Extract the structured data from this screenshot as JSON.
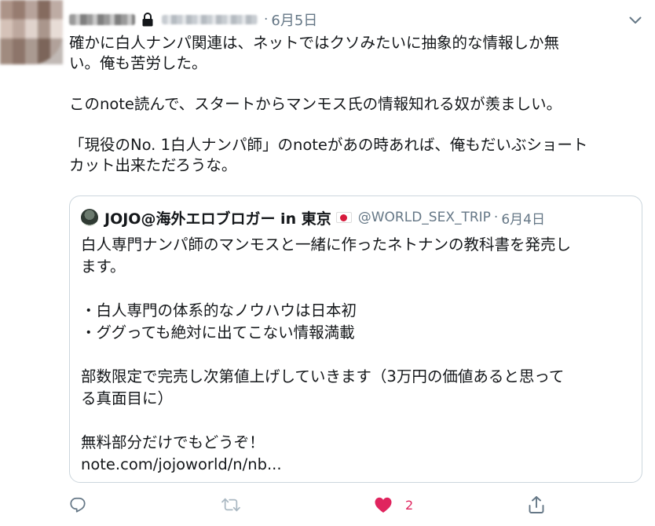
{
  "tweet": {
    "date": "6月5日",
    "lines": [
      "確かに白人ナンパ関連は、ネットではクソみたいに抽象的な情報しか無",
      "い。俺も苦労した。",
      "",
      "このnote読んで、スタートからマンモス氏の情報知れる奴が羨ましい。",
      "",
      "「現役のNo. 1白人ナンパ師」のnoteがあの時あれば、俺もだいぶショート",
      "カット出来ただろうな。"
    ]
  },
  "quote": {
    "name": "JOJO@海外エロブロガー in 東京",
    "handle": "@WORLD_SEX_TRIP",
    "separator": "·",
    "date": "6月4日",
    "lines": [
      "白人専門ナンパ師のマンモスと一緒に作ったネトナンの教科書を発売し",
      "ます。",
      "",
      "・白人専門の体系的なノウハウは日本初",
      "・ググっても絶対に出てこない情報満載",
      "",
      "部数限定で完売し次第値上げしていきます（3万円の価値あると思って",
      "る真面目に）",
      "",
      "無料部分だけでもどうぞ！",
      "note.com/jojoworld/n/nb..."
    ]
  },
  "actions": {
    "like_count": "2"
  },
  "colors": {
    "secondary_text": "#657786",
    "like_red": "#e0245e",
    "border": "#ccd6dd",
    "icon_gray": "#657786"
  },
  "icons": [
    "lock-icon",
    "chevron-down-icon",
    "reply-icon",
    "retweet-icon",
    "heart-icon",
    "share-icon"
  ]
}
